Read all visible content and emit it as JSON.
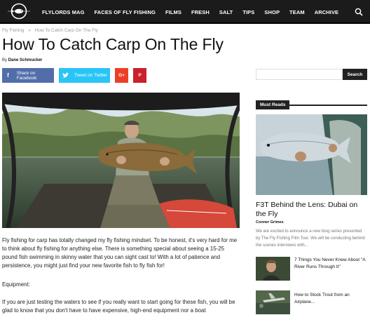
{
  "nav": {
    "logo_icon": "fish-circle-logo",
    "items": [
      "FLYLORDS MAG",
      "FACES OF FLY FISHING",
      "FILMS",
      "FRESH",
      "SALT",
      "TIPS",
      "SHOP",
      "TEAM",
      "ARCHIVE"
    ],
    "search_icon": "search-icon"
  },
  "breadcrumb": {
    "root": "Fly Fishing",
    "sep": "»",
    "current": "How To Catch Carp On The Fly"
  },
  "article": {
    "title": "How To Catch Carp On The Fly",
    "by_label": "By",
    "author": "Dane Schmucker",
    "share": {
      "facebook": "Share on Facebook",
      "twitter": "Tweet on Twitter",
      "gplus": "G+",
      "pinterest": "P"
    },
    "p1": "Fly fishing for carp has totally changed my fly fishing mindset. To be honest, it's very hard for me to think about fly fishing for anything else. There is something special about seeing a 15-25 pound fish swimming in skinny water that you can sight cast to! With a lot of patience and persistence, you might just find your new favorite fish to fly fish for!",
    "p2": "Equipment:",
    "p3": "If you are just testing the waters to see if you really want to start going for these fish, you will be glad to know that you don't have to have expensive, high-end equipment nor a boat"
  },
  "sidebar": {
    "search_placeholder": "",
    "search_button": "Search",
    "most_reads": "Must Reads",
    "featured": {
      "title": "F3T Behind the Lens: Dubai on the Fly",
      "author": "Conner Grimes",
      "excerpt": "We are excited to announce a new blog series presented by The Fly Fishing Film Tour. We will be conducting behind the scenes interviews with..."
    },
    "items": [
      {
        "title": "7 Things You Never Knew About \"A River Runs Through It\""
      },
      {
        "title": "How to Stock Trout from an Airplane..."
      }
    ]
  },
  "colors": {
    "nav_bg": "#1b1b1b",
    "facebook": "#516eab",
    "twitter": "#29c5f6",
    "gplus": "#eb4026",
    "pinterest": "#ca212a"
  }
}
